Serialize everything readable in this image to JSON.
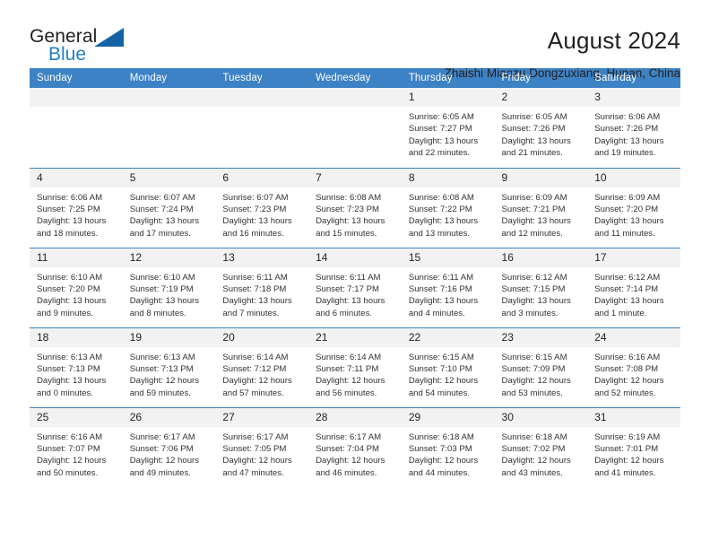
{
  "branding": {
    "name_part1": "General",
    "name_part2": "Blue",
    "logo_icon": "triangle-logo-icon"
  },
  "header": {
    "title": "August 2024",
    "subtitle": "Zhaishi Miaozu Dongzuxiang, Hunan, China"
  },
  "calendar": {
    "weekday_headers": [
      "Sunday",
      "Monday",
      "Tuesday",
      "Wednesday",
      "Thursday",
      "Friday",
      "Saturday"
    ],
    "accent_color": "#3c82c4",
    "daynum_bg": "#f2f2f2",
    "weeks": [
      [
        {
          "day": "",
          "blank": true
        },
        {
          "day": "",
          "blank": true
        },
        {
          "day": "",
          "blank": true
        },
        {
          "day": "",
          "blank": true
        },
        {
          "day": "1",
          "sunrise": "Sunrise: 6:05 AM",
          "sunset": "Sunset: 7:27 PM",
          "daylight": "Daylight: 13 hours and 22 minutes."
        },
        {
          "day": "2",
          "sunrise": "Sunrise: 6:05 AM",
          "sunset": "Sunset: 7:26 PM",
          "daylight": "Daylight: 13 hours and 21 minutes."
        },
        {
          "day": "3",
          "sunrise": "Sunrise: 6:06 AM",
          "sunset": "Sunset: 7:26 PM",
          "daylight": "Daylight: 13 hours and 19 minutes."
        }
      ],
      [
        {
          "day": "4",
          "sunrise": "Sunrise: 6:06 AM",
          "sunset": "Sunset: 7:25 PM",
          "daylight": "Daylight: 13 hours and 18 minutes."
        },
        {
          "day": "5",
          "sunrise": "Sunrise: 6:07 AM",
          "sunset": "Sunset: 7:24 PM",
          "daylight": "Daylight: 13 hours and 17 minutes."
        },
        {
          "day": "6",
          "sunrise": "Sunrise: 6:07 AM",
          "sunset": "Sunset: 7:23 PM",
          "daylight": "Daylight: 13 hours and 16 minutes."
        },
        {
          "day": "7",
          "sunrise": "Sunrise: 6:08 AM",
          "sunset": "Sunset: 7:23 PM",
          "daylight": "Daylight: 13 hours and 15 minutes."
        },
        {
          "day": "8",
          "sunrise": "Sunrise: 6:08 AM",
          "sunset": "Sunset: 7:22 PM",
          "daylight": "Daylight: 13 hours and 13 minutes."
        },
        {
          "day": "9",
          "sunrise": "Sunrise: 6:09 AM",
          "sunset": "Sunset: 7:21 PM",
          "daylight": "Daylight: 13 hours and 12 minutes."
        },
        {
          "day": "10",
          "sunrise": "Sunrise: 6:09 AM",
          "sunset": "Sunset: 7:20 PM",
          "daylight": "Daylight: 13 hours and 11 minutes."
        }
      ],
      [
        {
          "day": "11",
          "sunrise": "Sunrise: 6:10 AM",
          "sunset": "Sunset: 7:20 PM",
          "daylight": "Daylight: 13 hours and 9 minutes."
        },
        {
          "day": "12",
          "sunrise": "Sunrise: 6:10 AM",
          "sunset": "Sunset: 7:19 PM",
          "daylight": "Daylight: 13 hours and 8 minutes."
        },
        {
          "day": "13",
          "sunrise": "Sunrise: 6:11 AM",
          "sunset": "Sunset: 7:18 PM",
          "daylight": "Daylight: 13 hours and 7 minutes."
        },
        {
          "day": "14",
          "sunrise": "Sunrise: 6:11 AM",
          "sunset": "Sunset: 7:17 PM",
          "daylight": "Daylight: 13 hours and 6 minutes."
        },
        {
          "day": "15",
          "sunrise": "Sunrise: 6:11 AM",
          "sunset": "Sunset: 7:16 PM",
          "daylight": "Daylight: 13 hours and 4 minutes."
        },
        {
          "day": "16",
          "sunrise": "Sunrise: 6:12 AM",
          "sunset": "Sunset: 7:15 PM",
          "daylight": "Daylight: 13 hours and 3 minutes."
        },
        {
          "day": "17",
          "sunrise": "Sunrise: 6:12 AM",
          "sunset": "Sunset: 7:14 PM",
          "daylight": "Daylight: 13 hours and 1 minute."
        }
      ],
      [
        {
          "day": "18",
          "sunrise": "Sunrise: 6:13 AM",
          "sunset": "Sunset: 7:13 PM",
          "daylight": "Daylight: 13 hours and 0 minutes."
        },
        {
          "day": "19",
          "sunrise": "Sunrise: 6:13 AM",
          "sunset": "Sunset: 7:13 PM",
          "daylight": "Daylight: 12 hours and 59 minutes."
        },
        {
          "day": "20",
          "sunrise": "Sunrise: 6:14 AM",
          "sunset": "Sunset: 7:12 PM",
          "daylight": "Daylight: 12 hours and 57 minutes."
        },
        {
          "day": "21",
          "sunrise": "Sunrise: 6:14 AM",
          "sunset": "Sunset: 7:11 PM",
          "daylight": "Daylight: 12 hours and 56 minutes."
        },
        {
          "day": "22",
          "sunrise": "Sunrise: 6:15 AM",
          "sunset": "Sunset: 7:10 PM",
          "daylight": "Daylight: 12 hours and 54 minutes."
        },
        {
          "day": "23",
          "sunrise": "Sunrise: 6:15 AM",
          "sunset": "Sunset: 7:09 PM",
          "daylight": "Daylight: 12 hours and 53 minutes."
        },
        {
          "day": "24",
          "sunrise": "Sunrise: 6:16 AM",
          "sunset": "Sunset: 7:08 PM",
          "daylight": "Daylight: 12 hours and 52 minutes."
        }
      ],
      [
        {
          "day": "25",
          "sunrise": "Sunrise: 6:16 AM",
          "sunset": "Sunset: 7:07 PM",
          "daylight": "Daylight: 12 hours and 50 minutes."
        },
        {
          "day": "26",
          "sunrise": "Sunrise: 6:17 AM",
          "sunset": "Sunset: 7:06 PM",
          "daylight": "Daylight: 12 hours and 49 minutes."
        },
        {
          "day": "27",
          "sunrise": "Sunrise: 6:17 AM",
          "sunset": "Sunset: 7:05 PM",
          "daylight": "Daylight: 12 hours and 47 minutes."
        },
        {
          "day": "28",
          "sunrise": "Sunrise: 6:17 AM",
          "sunset": "Sunset: 7:04 PM",
          "daylight": "Daylight: 12 hours and 46 minutes."
        },
        {
          "day": "29",
          "sunrise": "Sunrise: 6:18 AM",
          "sunset": "Sunset: 7:03 PM",
          "daylight": "Daylight: 12 hours and 44 minutes."
        },
        {
          "day": "30",
          "sunrise": "Sunrise: 6:18 AM",
          "sunset": "Sunset: 7:02 PM",
          "daylight": "Daylight: 12 hours and 43 minutes."
        },
        {
          "day": "31",
          "sunrise": "Sunrise: 6:19 AM",
          "sunset": "Sunset: 7:01 PM",
          "daylight": "Daylight: 12 hours and 41 minutes."
        }
      ]
    ]
  }
}
